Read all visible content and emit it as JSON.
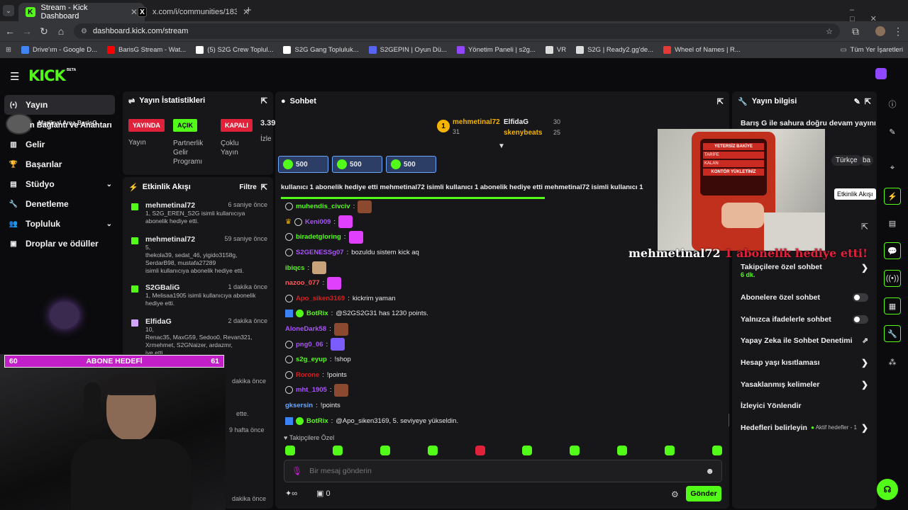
{
  "browser": {
    "tabs": [
      {
        "title": "Stream - Kick Dashboard"
      },
      {
        "title": "x.com/i/communities/1835319..."
      }
    ],
    "url": "dashboard.kick.com/stream",
    "bookmarks": [
      {
        "label": "Drive'ım - Google D...",
        "color": "#4285f4"
      },
      {
        "label": "BarisG Stream - Wat...",
        "color": "#ff0000"
      },
      {
        "label": "(5) S2G Crew Toplul...",
        "color": "#ffffff"
      },
      {
        "label": "S2G Gang Topluluk...",
        "color": "#ffffff"
      },
      {
        "label": "S2GEPIN | Oyun Dü...",
        "color": "#5865f2"
      },
      {
        "label": "Yönetim Paneli | s2g...",
        "color": "#9146ff"
      },
      {
        "label": "VR",
        "color": "#dddddd"
      },
      {
        "label": "S2G | Ready2.gg'de...",
        "color": "#dddddd"
      },
      {
        "label": "Wheel of Names | R...",
        "color": "#e53935"
      }
    ],
    "all_bookmarks": "Tüm Yer İşaretleri"
  },
  "kick": {
    "logo": "KICK",
    "beta": "BETA"
  },
  "nav": {
    "items": [
      {
        "label": "Yayın",
        "icon": "broadcast-icon"
      },
      {
        "label": "Gelir",
        "icon": "chart-icon"
      },
      {
        "label": "Başarılar",
        "icon": "trophy-icon"
      },
      {
        "label": "Stüdyo",
        "icon": "studio-icon"
      },
      {
        "label": "Denetleme",
        "icon": "wrench-icon"
      },
      {
        "label": "Topluluk",
        "icon": "community-icon"
      },
      {
        "label": "Droplar ve ödüller",
        "icon": "drops-icon"
      }
    ],
    "overlay_text": "Marjinal Ama BarisG",
    "overlay_text2": "n Bağlantı ve Anahtarı"
  },
  "stats": {
    "title": "Yayın İstatistikleri",
    "badges": [
      {
        "label": "YAYINDA",
        "color": "#e0213a",
        "caption": "Yayın"
      },
      {
        "label": "AÇIK",
        "color": "#53fc18",
        "caption": "Partnerlik Gelir Programı"
      },
      {
        "label": "KAPALI",
        "color": "#e0213a",
        "caption": "Çoklu Yayın"
      }
    ],
    "viewers": "3.39",
    "viewers_label": "İzle"
  },
  "activity": {
    "title": "Etkinlik Akışı",
    "filter": "Filtre",
    "items": [
      {
        "name": "mehmetinal72",
        "time": "6 saniye önce",
        "line1": "1, S2G_EREN_S2G isimli kullanıcıya",
        "line2": "abonelik hediye etti."
      },
      {
        "name": "mehmetinal72",
        "time": "59 saniye önce",
        "line1": "5,",
        "line2": "thekola39, sedat_46, yigido3158g, SerdarB98, mustafa27289",
        "line3": "isimli kullanıcıya abonelik hediye etti."
      },
      {
        "name": "S2GBaliG",
        "time": "1 dakika önce",
        "line1": "1, Melisaa1905 isimli kullanıcıya abonelik",
        "line2": "hediye etti."
      },
      {
        "name": "ElfidaG",
        "time": "2 dakika önce",
        "line1": "10,",
        "line2": "Renac35, MaxG59, Sedoo0, Revan321, Xrmehmet, S2GNaizer, ardazmr,",
        "line3": "iye etti."
      }
    ],
    "hidden_times": [
      "dakika önce",
      "ette.",
      "9 hafta önce",
      "dakika önce"
    ]
  },
  "goal": {
    "left": "60",
    "label": "ABONE HEDEFİ",
    "right": "61"
  },
  "chat": {
    "title": "Sohbet",
    "leaders": [
      {
        "name": "mehmetinal72",
        "count": "31",
        "rank": "1"
      },
      {
        "name": "ElfidaG",
        "count": "30"
      },
      {
        "name": "skenybeats",
        "count": "25"
      }
    ],
    "gifts": [
      "500",
      "500",
      "500"
    ],
    "ticker": "kullanıcı 1 abonelik hediye etti  mehmetinal72 isimli kullanıcı 1 abonelik hediye etti  mehmetinal72 isimli kullanıcı 1",
    "messages": [
      {
        "user": "muhendis_civciv",
        "color": "#53fc18",
        "text": "",
        "emote": "#8b4a2f"
      },
      {
        "user": "Keni009",
        "color": "#a855f7",
        "text": "",
        "emote": "#e040fb"
      },
      {
        "user": "biradetgloring",
        "color": "#53fc18",
        "text": "",
        "emote": "#e040fb"
      },
      {
        "user": "S2GENESSg07",
        "color": "#a855f7",
        "text": "bozuldu sistem kick aq",
        "emote": ""
      },
      {
        "user": "ibiqcs",
        "color": "#53fc18",
        "text": "",
        "emote": "#c8a27a"
      },
      {
        "user": "nazoo_077",
        "color": "#ff5a5a",
        "text": "",
        "emote": "#e040fb"
      },
      {
        "user": "Apo_siken3169",
        "color": "#d62020",
        "text": "kickrim yaman",
        "emote": ""
      },
      {
        "user": "BotRix",
        "color": "#53fc18",
        "text": "@S2GS2G31 has 1230 points.",
        "emote": ""
      },
      {
        "user": "AloneDark58",
        "color": "#a855f7",
        "text": "",
        "emote": "#8b4a2f"
      },
      {
        "user": "png0_06",
        "color": "#a855f7",
        "text": "",
        "emote": "#7a5cff"
      },
      {
        "user": "s2g_eyup",
        "color": "#53fc18",
        "text": "!shop",
        "emote": ""
      },
      {
        "user": "Rorone",
        "color": "#d62020",
        "text": "!points",
        "emote": ""
      },
      {
        "user": "mht_1905",
        "color": "#a855f7",
        "text": "",
        "emote": "#8b4a2f"
      },
      {
        "user": "gksersin",
        "color": "#6aa9ff",
        "text": "!points",
        "emote": ""
      },
      {
        "user": "BotRix",
        "color": "#53fc18",
        "text": "@Apo_siken3169, 5. seviyeye yükseldin.",
        "emote": ""
      }
    ],
    "followers_only": "Takipçilere Özel",
    "input_placeholder": "Bir mesaj gönderin",
    "points": "0",
    "send": "Gönder"
  },
  "info": {
    "title": "Yayın bilgisi",
    "stream_title": "Barış G ile sahura doğru devam yayını",
    "lang": "Türkçe",
    "lang2": "ba",
    "tooltip": "Etkinlik Akışı",
    "alert_user": "mehmetinal72",
    "alert_text": "1 abonelik hediye etti!",
    "video_texts": [
      "YETERSİZ BAKİYE",
      "TARİFE",
      "KALAN",
      "KONTÖR YÜKLETİNİZ"
    ],
    "rows": [
      {
        "label": "Takipçilere özel sohbet",
        "sub": "6 dk.",
        "ctrl": "chevron"
      },
      {
        "label": "Abonelere özel sohbet",
        "ctrl": "toggle"
      },
      {
        "label": "Yalnızca ifadelerle sohbet",
        "ctrl": "toggle"
      },
      {
        "label": "Yapay Zeka ile Sohbet Denetimi",
        "ctrl": "external"
      },
      {
        "label": "Hesap yaşı kısıtlaması",
        "ctrl": "chevron"
      },
      {
        "label": "Yasaklanmış kelimeler",
        "ctrl": "chevron"
      },
      {
        "label": "İzleyici Yönlendir",
        "ctrl": ""
      },
      {
        "label": "Hedefleri belirleyin",
        "ctrl": "chevron",
        "extra": "Aktif hedefler - 1"
      }
    ]
  }
}
